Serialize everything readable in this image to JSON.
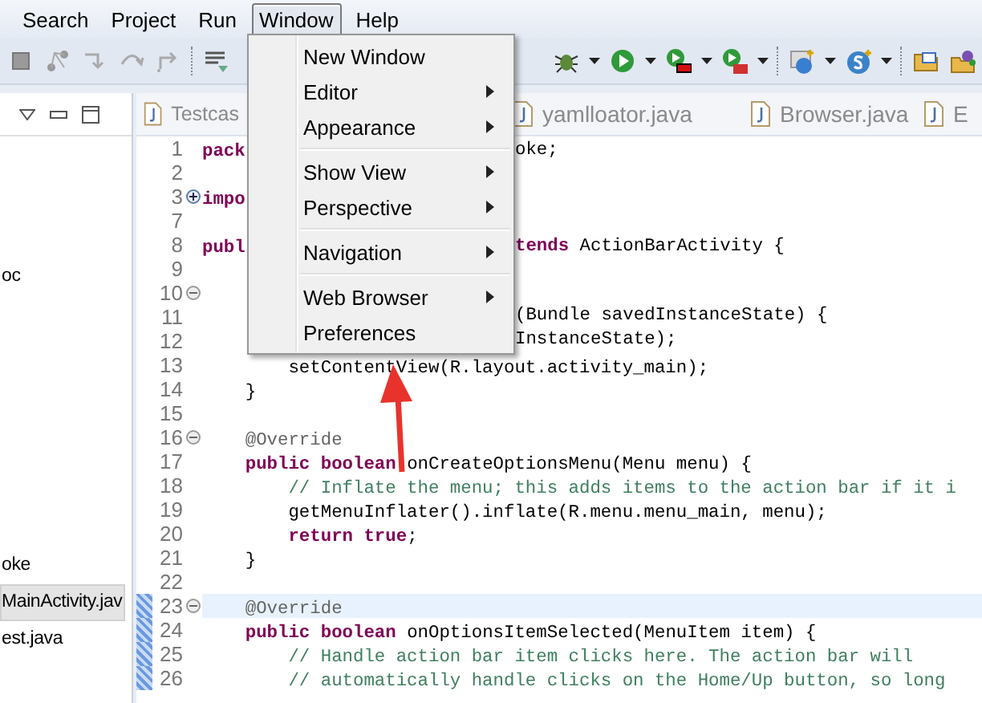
{
  "menu_bar": [
    {
      "label": "Search",
      "selected": false
    },
    {
      "label": "Project",
      "selected": false
    },
    {
      "label": "Run",
      "selected": false
    },
    {
      "label": "Window",
      "selected": true
    },
    {
      "label": "Help",
      "selected": false
    }
  ],
  "window_menu": [
    {
      "kind": "item",
      "label": "New Window",
      "submenu": false
    },
    {
      "kind": "item",
      "label": "Editor",
      "submenu": true
    },
    {
      "kind": "item",
      "label": "Appearance",
      "submenu": true
    },
    {
      "kind": "separator"
    },
    {
      "kind": "item",
      "label": "Show View",
      "submenu": true
    },
    {
      "kind": "item",
      "label": "Perspective",
      "submenu": true
    },
    {
      "kind": "separator"
    },
    {
      "kind": "item",
      "label": "Navigation",
      "submenu": true
    },
    {
      "kind": "separator"
    },
    {
      "kind": "item",
      "label": "Web Browser",
      "submenu": true
    },
    {
      "kind": "item",
      "label": "Preferences",
      "submenu": false
    }
  ],
  "explorer": {
    "items": [
      {
        "label": "oc",
        "selected": false
      },
      {
        "label": "oke",
        "selected": false
      },
      {
        "label": "MainActivity.jav",
        "selected": true
      },
      {
        "label": "est.java",
        "selected": false
      }
    ]
  },
  "editor_tabs": [
    {
      "label": "Testcas"
    },
    {
      "label": "yamlloator.java"
    },
    {
      "label": "Browser.java"
    },
    {
      "label": "E"
    }
  ],
  "code_lines": [
    {
      "number": "1",
      "code": [
        {
          "kind": "keyword",
          "text": "pack"
        }
      ],
      "after_menu": [
        {
          "kind": "plain",
          "text": "oke;"
        }
      ]
    },
    {
      "number": "2"
    },
    {
      "number": "3",
      "expanded": false,
      "code": [
        {
          "kind": "keyword",
          "text": "impo"
        }
      ]
    },
    {
      "number": "7"
    },
    {
      "number": "8",
      "code": [
        {
          "kind": "keyword",
          "text": "publ"
        }
      ],
      "after_menu": [
        {
          "kind": "keyword",
          "text": "tends"
        },
        {
          "kind": "plain",
          "text": " ActionBarActivity {"
        }
      ]
    },
    {
      "number": "9"
    },
    {
      "number": "10",
      "expanded": true
    },
    {
      "number": "11",
      "after_menu": [
        {
          "kind": "plain",
          "text": "(Bundle savedInstanceState) {"
        }
      ]
    },
    {
      "number": "12",
      "after_menu": [
        {
          "kind": "plain",
          "text": "InstanceState);"
        }
      ]
    },
    {
      "number": "13",
      "code": [
        {
          "kind": "plain",
          "text": "        setContentView(R.layout.activity_main);"
        }
      ]
    },
    {
      "number": "14",
      "code": [
        {
          "kind": "plain",
          "text": "    }"
        }
      ]
    },
    {
      "number": "15"
    },
    {
      "number": "16",
      "expanded": true,
      "code": [
        {
          "kind": "annotation",
          "text": "    @Override"
        }
      ]
    },
    {
      "number": "17",
      "code": [
        {
          "kind": "keyword",
          "text": "    public boolean"
        },
        {
          "kind": "plain",
          "text": " onCreateOptionsMenu(Menu menu) {"
        }
      ]
    },
    {
      "number": "18",
      "code": [
        {
          "kind": "comment",
          "text": "        // Inflate the menu; this adds items to the action bar if it i"
        }
      ]
    },
    {
      "number": "19",
      "code": [
        {
          "kind": "plain",
          "text": "        getMenuInflater().inflate(R.menu.menu_main, menu);"
        }
      ]
    },
    {
      "number": "20",
      "code": [
        {
          "kind": "keyword",
          "text": "        return true"
        },
        {
          "kind": "plain",
          "text": ";"
        }
      ]
    },
    {
      "number": "21",
      "code": [
        {
          "kind": "plain",
          "text": "    }"
        }
      ]
    },
    {
      "number": "22"
    },
    {
      "number": "23",
      "expanded": true,
      "current": true,
      "marked": true,
      "code": [
        {
          "kind": "annotation",
          "text": "    @Override"
        }
      ]
    },
    {
      "number": "24",
      "marked": true,
      "code": [
        {
          "kind": "keyword",
          "text": "    public boolean"
        },
        {
          "kind": "plain",
          "text": " onOptionsItemSelected(MenuItem item) {"
        }
      ]
    },
    {
      "number": "25",
      "marked": true,
      "code": [
        {
          "kind": "comment",
          "text": "        // Handle action bar item clicks here. The action bar will"
        }
      ]
    },
    {
      "number": "26",
      "marked": true,
      "code": [
        {
          "kind": "comment",
          "text": "        // automatically handle clicks on the Home/Up button, so long"
        }
      ]
    }
  ]
}
